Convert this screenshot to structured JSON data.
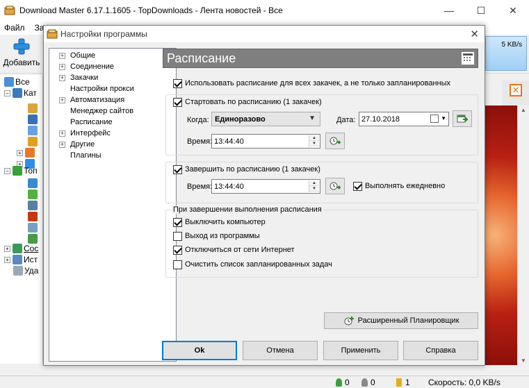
{
  "main_window": {
    "title": "Download Master 6.17.1.1605 - TopDownloads - Лента новостей - Все",
    "menu": [
      "Файл",
      "За"
    ],
    "toolbar": {
      "add_label": "Добавить"
    },
    "speed_indicator": "5 KB/s",
    "tree": [
      {
        "label": "Все",
        "expander": ""
      },
      {
        "label": "Кат",
        "expander": "−"
      },
      {
        "label": "Топ",
        "expander": "−"
      },
      {
        "label": "Сос",
        "expander": "+"
      },
      {
        "label": "Ист",
        "expander": "+"
      },
      {
        "label": "Уда",
        "expander": ""
      }
    ],
    "status": {
      "active": "0",
      "paused": "0",
      "queued": "1",
      "speed": "Скорость: 0,0 KB/s"
    }
  },
  "dialog": {
    "title": "Настройки программы",
    "nav": [
      {
        "label": "Общие",
        "expandable": true
      },
      {
        "label": "Соединение",
        "expandable": true
      },
      {
        "label": "Закачки",
        "expandable": true
      },
      {
        "label": "Настройки прокси",
        "expandable": false
      },
      {
        "label": "Автоматизация",
        "expandable": true
      },
      {
        "label": "Менеджер сайтов",
        "expandable": false
      },
      {
        "label": "Расписание",
        "expandable": false
      },
      {
        "label": "Интерфейс",
        "expandable": true
      },
      {
        "label": "Другие",
        "expandable": true
      },
      {
        "label": "Плагины",
        "expandable": false
      }
    ],
    "section_title": "Расписание",
    "use_schedule": {
      "label": "Использовать расписание для всех закачек, а не только запланированных",
      "checked": true
    },
    "start": {
      "label": "Стартовать по расписанию  (1 закачек)",
      "checked": true,
      "when_label": "Когда:",
      "when_value": "Единоразово",
      "date_label": "Дата:",
      "date_value": "27.10.2018",
      "time_label": "Время:",
      "time_value": "13:44:40"
    },
    "stop": {
      "label": "Завершить по расписанию  (1 закачек)",
      "checked": true,
      "time_label": "Время:",
      "time_value": "13:44:40",
      "daily_label": "Выполнять ежедневно",
      "daily_checked": true
    },
    "on_complete": {
      "title": "При завершении выполнения расписания",
      "options": [
        {
          "label": "Выключить компьютер",
          "checked": true
        },
        {
          "label": "Выход из программы",
          "checked": false
        },
        {
          "label": "Отключиться от сети Интернет",
          "checked": true
        },
        {
          "label": "Очистить список запланированных задач",
          "checked": false
        }
      ]
    },
    "advanced_button": "Расширенный Планировщик",
    "buttons": {
      "ok": "Ok",
      "cancel": "Отмена",
      "apply": "Применить",
      "help": "Справка"
    }
  },
  "colors": {
    "section_header_bg": "#7f7f7f",
    "accent_blue": "#0078d7",
    "orange": "#e8731a"
  }
}
